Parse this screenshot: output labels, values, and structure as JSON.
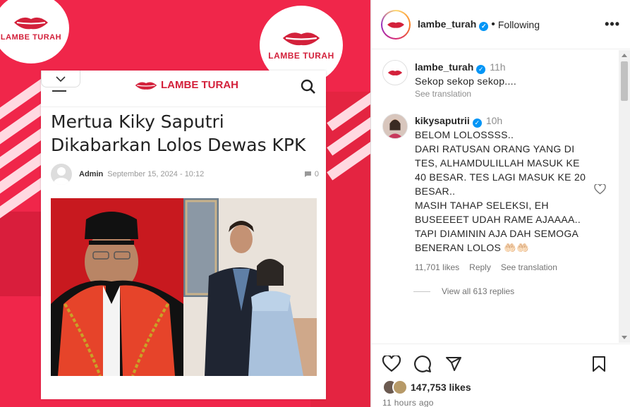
{
  "post_image": {
    "logo_text": "LAMBE TURAH",
    "article": {
      "site_name": "LAMBE TURAH",
      "headline": "Mertua Kiky Saputri Dikabarkan Lolos Dewas KPK",
      "author": "Admin",
      "date": "September 15, 2024 - 10:12",
      "comment_count": "0"
    }
  },
  "header": {
    "username": "lambe_turah",
    "follow_status": "Following",
    "separator": "•",
    "more_label": "•••"
  },
  "caption": {
    "username": "lambe_turah",
    "time": "11h",
    "text": "Sekop sekop sekop....",
    "see_translation": "See translation"
  },
  "comment": {
    "username": "kikysaputrii",
    "time": "10h",
    "lines": [
      "BELOM LOLOSSSS..",
      "DARI RATUSAN ORANG YANG DI",
      "TES, ALHAMDULILLAH MASUK KE",
      "40 BESAR. TES LAGI MASUK KE 20",
      "BESAR..",
      "MASIH TAHAP SELEKSI, EH",
      "BUSEEEET UDAH RAME AJAAAA..",
      "TAPI DIAMININ AJA DAH SEMOGA",
      "BENERAN LOLOS 🤲🏻🤲🏻"
    ],
    "likes": "11,701 likes",
    "reply_label": "Reply",
    "see_translation": "See translation",
    "view_replies": "View all 613 replies"
  },
  "footer": {
    "likes_count": "147,753 likes",
    "time_ago": "11 hours ago"
  },
  "colors": {
    "brand_red": "#f0264a",
    "verified_blue": "#0095f6",
    "muted_text": "#8e8e8e"
  },
  "icons": [
    "chevron-down-icon",
    "menu-icon",
    "search-icon",
    "lips-logo-icon",
    "verified-icon",
    "more-icon",
    "heart-icon",
    "comment-icon",
    "share-icon",
    "bookmark-icon"
  ]
}
